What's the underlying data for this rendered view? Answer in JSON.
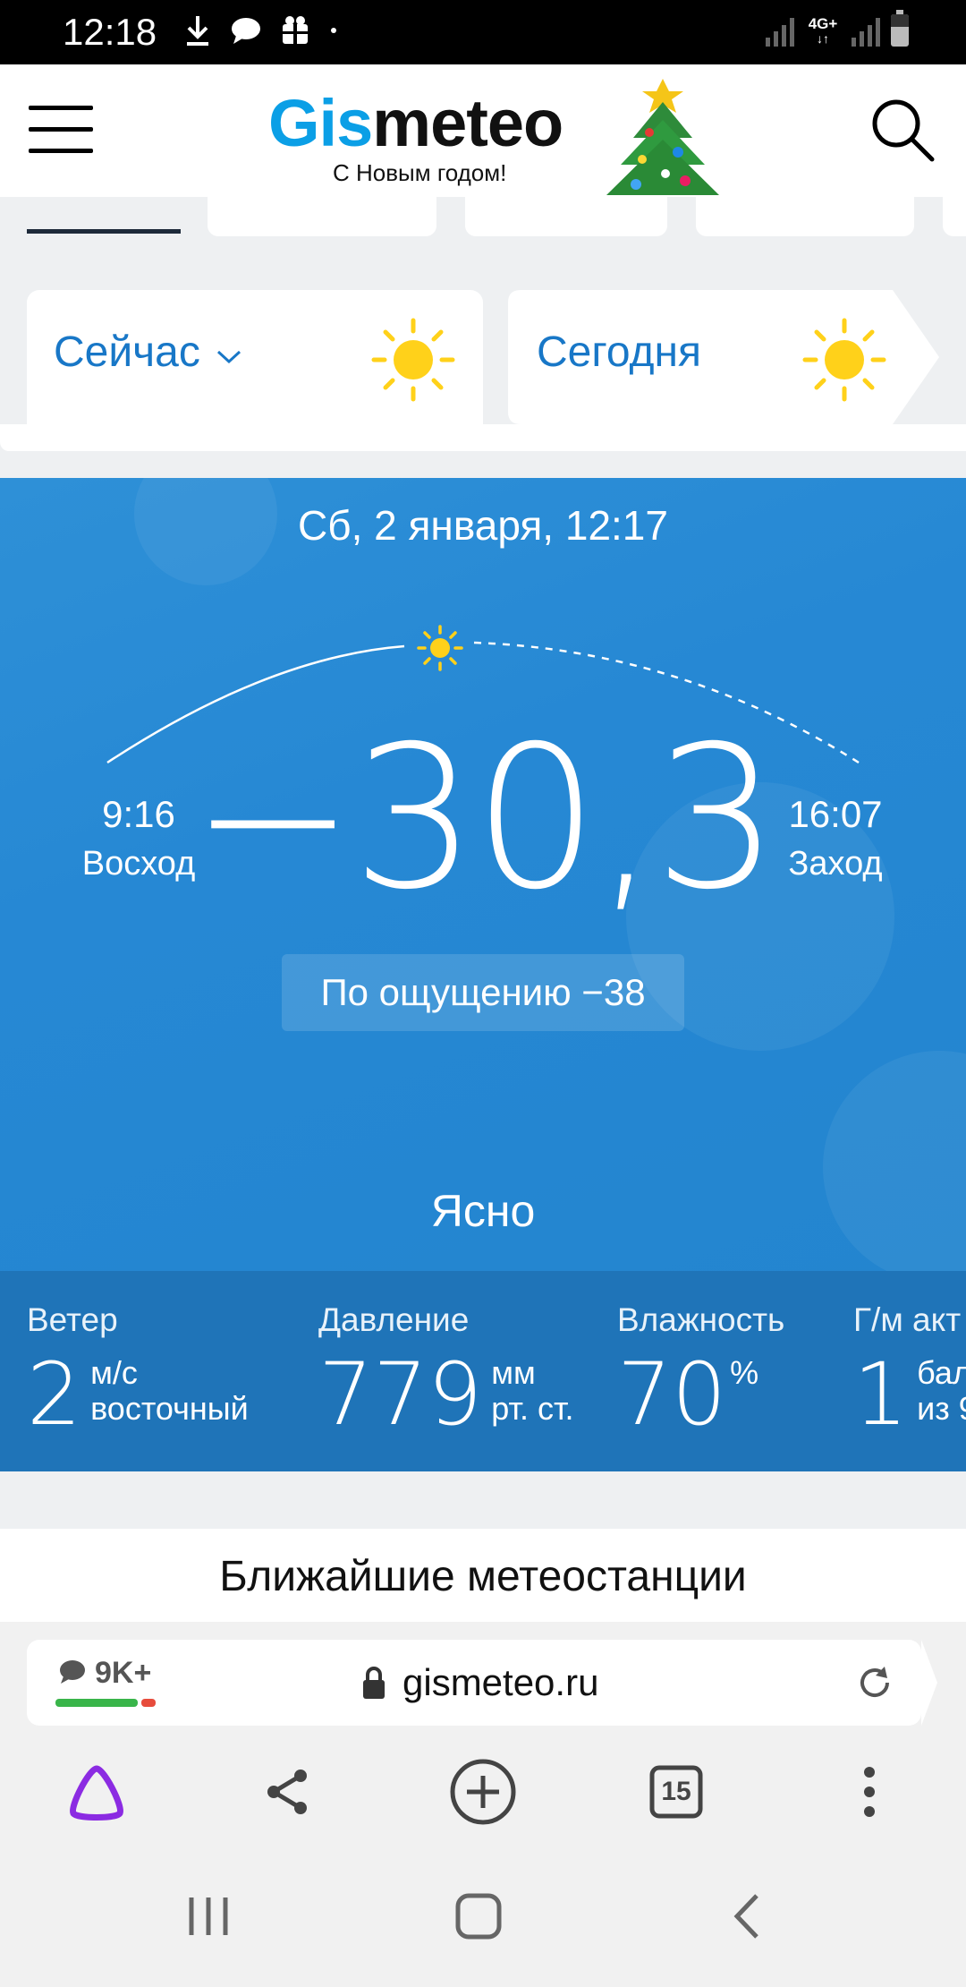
{
  "status_bar": {
    "time": "12:18",
    "network": "4G+",
    "icons": [
      "download-icon",
      "message-icon",
      "gift-icon",
      "dot-icon",
      "signal-icon",
      "signal-icon",
      "battery-icon"
    ]
  },
  "header": {
    "logo_part1": "Gis",
    "logo_part2": "meteo",
    "tagline": "С Новым годом!",
    "brand_color": "#0b9fe6"
  },
  "cards": {
    "now_label": "Сейчас",
    "today_label": "Сегодня"
  },
  "weather": {
    "datetime": "Сб, 2 января, 12:17",
    "sunrise_time": "9:16",
    "sunrise_label": "Восход",
    "sunset_time": "16:07",
    "sunset_label": "Заход",
    "temperature": "−30,3",
    "feels_like": "По ощущению −38",
    "condition": "Ясно"
  },
  "metrics": {
    "wind": {
      "label": "Ветер",
      "value": "2",
      "unit1": "м/с",
      "unit2": "восточный"
    },
    "pressure": {
      "label": "Давление",
      "value": "779",
      "unit1": "мм",
      "unit2": "рт. ст."
    },
    "humidity": {
      "label": "Влажность",
      "value": "70",
      "unit1": "%"
    },
    "geomag": {
      "label": "Г/м акт",
      "value": "1",
      "unit1": "бал",
      "unit2": "из 9"
    }
  },
  "stations": {
    "title": "Ближайшие метеостанции"
  },
  "browser": {
    "comments_count": "9K+",
    "url": "gismeteo.ru",
    "tabs_count": "15"
  },
  "colors": {
    "sky": "#2688d4",
    "metrics_bg": "#1f74b8",
    "card_text": "#1877c7",
    "sun": "#ffd11a"
  }
}
